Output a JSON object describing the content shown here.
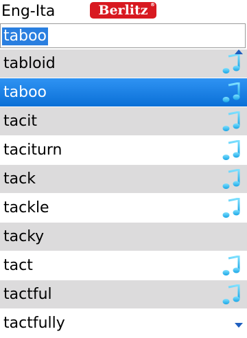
{
  "header": {
    "title": "Eng-Ita",
    "logo_text": "Berlitz"
  },
  "search": {
    "value": "taboo"
  },
  "colors": {
    "selection": "#1f86ea",
    "row_grey": "#dcdbdc",
    "note": "#2ec3f0"
  },
  "list": {
    "items": [
      {
        "word": "tabloid",
        "audio": true,
        "style": "grey"
      },
      {
        "word": "taboo",
        "audio": true,
        "style": "selected"
      },
      {
        "word": "tacit",
        "audio": true,
        "style": "grey"
      },
      {
        "word": "taciturn",
        "audio": true,
        "style": "white"
      },
      {
        "word": "tack",
        "audio": true,
        "style": "grey"
      },
      {
        "word": "tackle",
        "audio": true,
        "style": "white"
      },
      {
        "word": "tacky",
        "audio": false,
        "style": "grey"
      },
      {
        "word": "tact",
        "audio": true,
        "style": "white"
      },
      {
        "word": "tactful",
        "audio": true,
        "style": "grey"
      },
      {
        "word": "tactfully",
        "audio": false,
        "style": "white"
      }
    ]
  }
}
